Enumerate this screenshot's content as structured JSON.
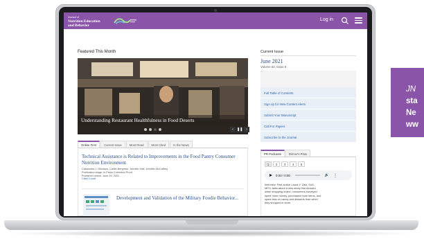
{
  "colors": {
    "brand_purple": "#8a54a8",
    "link_blue": "#2a4f8a",
    "nav_link_blue": "#2a64b0",
    "link_bg": "#e9eff6"
  },
  "header": {
    "logo_lines": [
      "Journal of",
      "Nutrition Education",
      "and Behavior"
    ],
    "logo_mark": "sne-logo",
    "login_label": "Log in",
    "search_icon": "search-icon",
    "menu_icon": "menu-icon"
  },
  "featured": {
    "heading": "Featured This Month",
    "caption": "Understanding Restaurant Healthfulness in Food Deserts",
    "carousel_dots": 4,
    "carousel_active": 2,
    "controls": [
      "prev-icon",
      "pause-icon",
      "next-icon"
    ]
  },
  "tabs": {
    "items": [
      "Online First",
      "Current Issue",
      "Most Read",
      "Most Cited",
      "In the News"
    ],
    "active": 0
  },
  "articles": [
    {
      "title": "Technical Assistance is Related to Improvements in the Food Pantry Consumer Nutrition Environment",
      "authors": "Cassandra J. Nikolaus, Caitlin Bergman, Jennifer Hall, Jennifer McCaffrey",
      "stage": "Publication stage: In Press Corrected Proof",
      "date": "Published online: June 29, 2021",
      "more": "Cited Count"
    },
    {
      "title": "Development and Validation of the Military Foodie Behavior..."
    }
  ],
  "current_issue": {
    "heading": "Current Issue",
    "date": "June 2021",
    "volume": "Volume 53, Issue 6",
    "links": [
      "Full Table of Contents",
      "Sign up for New Content Alerts",
      "Submit Your Manuscript",
      "Call For Papers",
      "Subscribe to the Journal"
    ]
  },
  "podcasts": {
    "tabs": [
      "PR Podcasts",
      "Dinner's Plate"
    ],
    "active_tab": 0,
    "pages": [
      "1",
      "2",
      "3",
      "4",
      "5"
    ],
    "active_page": 0,
    "player_time": "0:00 / 0:00",
    "description": [
      "Interview: First author Laura Y. Zatz, ScD,",
      "MPH, talks about a new study that showed",
      "when shopping online, consumers surveyed",
      "spent more money, purchased more items, and",
      "spent less on candy and desserts than when",
      "they shopped in store."
    ]
  },
  "promo": {
    "lines": [
      "JN",
      "sta",
      "Ne",
      "ww"
    ]
  }
}
